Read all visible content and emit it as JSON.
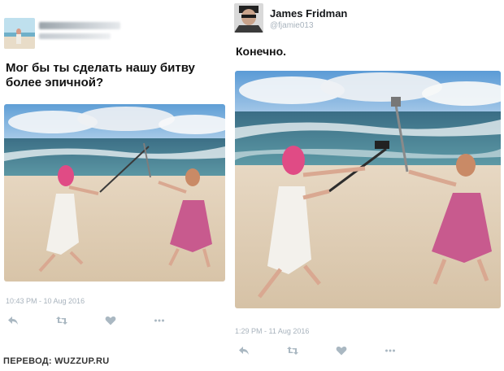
{
  "left_tweet": {
    "display_name": "",
    "handle": "",
    "text": "Мог бы ты сделать нашу битву более эпичной?",
    "timestamp": "10:43 PM - 10 Aug 2016",
    "actions": [
      "reply-icon",
      "retweet-icon",
      "like-icon",
      "more-icon"
    ]
  },
  "right_tweet": {
    "display_name": "James Fridman",
    "handle": "@fjamie013",
    "text": "Конечно.",
    "timestamp": "1:29 PM - 11 Aug 2016",
    "actions": [
      "reply-icon",
      "retweet-icon",
      "like-icon",
      "more-icon"
    ]
  },
  "footer": {
    "credit": "ПЕРЕВОД: WUZZUP.RU"
  },
  "colors": {
    "meta_gray": "#a8b3bd",
    "icon_gray": "#aab8c2",
    "text": "#111111"
  }
}
